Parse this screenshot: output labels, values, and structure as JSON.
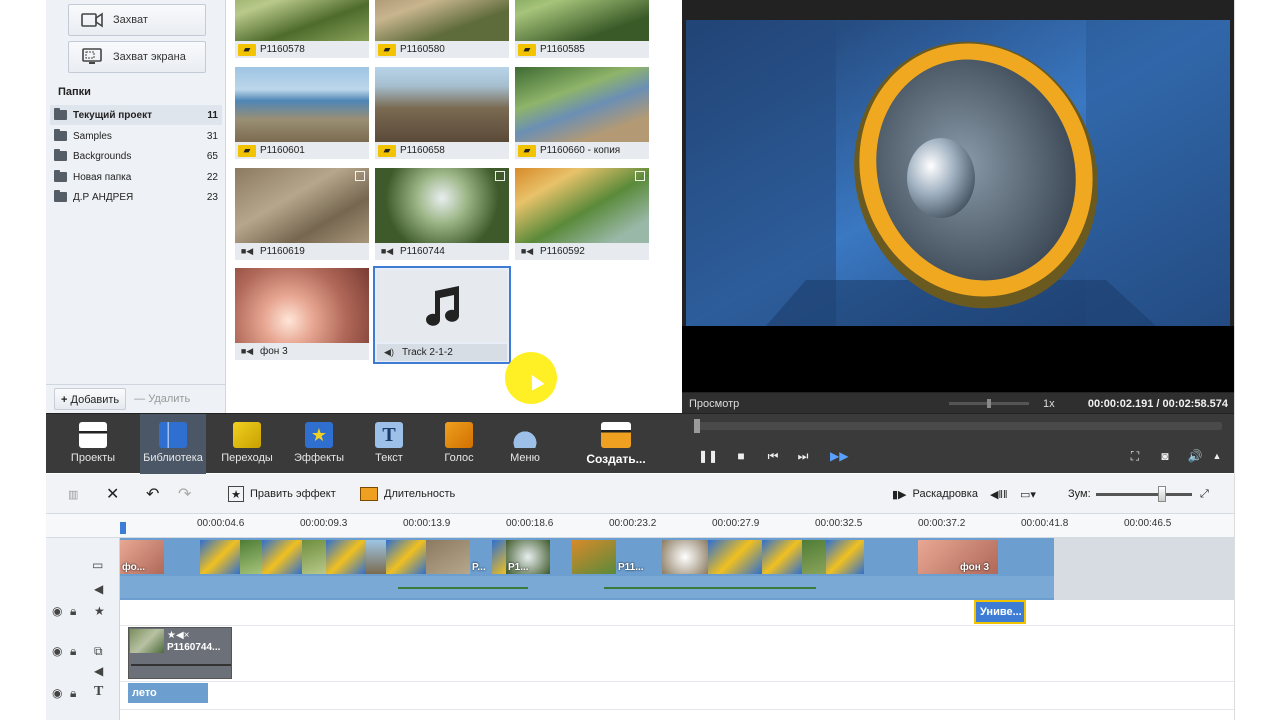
{
  "sidebar": {
    "capture_label": "Захват",
    "screen_capture_label": "Захват экрана",
    "folders_header": "Папки",
    "folders": [
      {
        "name": "Текущий проект",
        "count": "11"
      },
      {
        "name": "Samples",
        "count": "31"
      },
      {
        "name": "Backgrounds",
        "count": "65"
      },
      {
        "name": "Новая папка",
        "count": "22"
      },
      {
        "name": "Д.Р АНДРЕЯ",
        "count": "23"
      }
    ],
    "add_label": "Добавить",
    "delete_label": "Удалить"
  },
  "library": {
    "items": [
      {
        "name": "P1160578",
        "type": "photo"
      },
      {
        "name": "P1160580",
        "type": "photo"
      },
      {
        "name": "P1160585",
        "type": "photo"
      },
      {
        "name": "P1160601",
        "type": "photo"
      },
      {
        "name": "P1160658",
        "type": "photo"
      },
      {
        "name": "P1160660 - копия",
        "type": "photo"
      },
      {
        "name": "P1160619",
        "type": "video"
      },
      {
        "name": "P1160744",
        "type": "video"
      },
      {
        "name": "P1160592",
        "type": "video"
      },
      {
        "name": "фон 3",
        "type": "video"
      },
      {
        "name": "Track  2-1-2",
        "type": "audio"
      }
    ]
  },
  "preview": {
    "label": "Просмотр",
    "speed": "1x",
    "current_time": "00:00:02.191",
    "separator": "/",
    "total_time": "00:02:58.574"
  },
  "toolbar": {
    "tools": [
      {
        "label": "Проекты",
        "icon": "clapper-icon"
      },
      {
        "label": "Библиотека",
        "icon": "library-icon"
      },
      {
        "label": "Переходы",
        "icon": "transitions-icon"
      },
      {
        "label": "Эффекты",
        "icon": "effects-icon"
      },
      {
        "label": "Текст",
        "icon": "text-icon"
      },
      {
        "label": "Голос",
        "icon": "microphone-icon"
      },
      {
        "label": "Меню",
        "icon": "menu-icon"
      }
    ],
    "create_label": "Создать..."
  },
  "timeline_toolbar": {
    "edit_effect_label": "Править эффект",
    "duration_label": "Длительность",
    "storyboard_label": "Раскадровка",
    "zoom_label": "Зум:"
  },
  "ruler": {
    "ticks": [
      "00:00:04.6",
      "00:00:09.3",
      "00:00:13.9",
      "00:00:18.6",
      "00:00:23.2",
      "00:00:27.9",
      "00:00:32.5",
      "00:00:37.2",
      "00:00:41.8",
      "00:00:46.5"
    ]
  },
  "timeline": {
    "video_clip_labels": [
      "фо...",
      "P...",
      "P1...",
      "P11...",
      "фон 3"
    ],
    "effect_clip_label": "Униве...",
    "overlay_clip_label": "P1160744...",
    "text_clip_label": "лето"
  },
  "colors": {
    "accent": "#3e7dd6",
    "toolbar_bg": "#3a3a3a",
    "photo_badge": "#f2c300",
    "video_track": "#6c9fd0"
  }
}
